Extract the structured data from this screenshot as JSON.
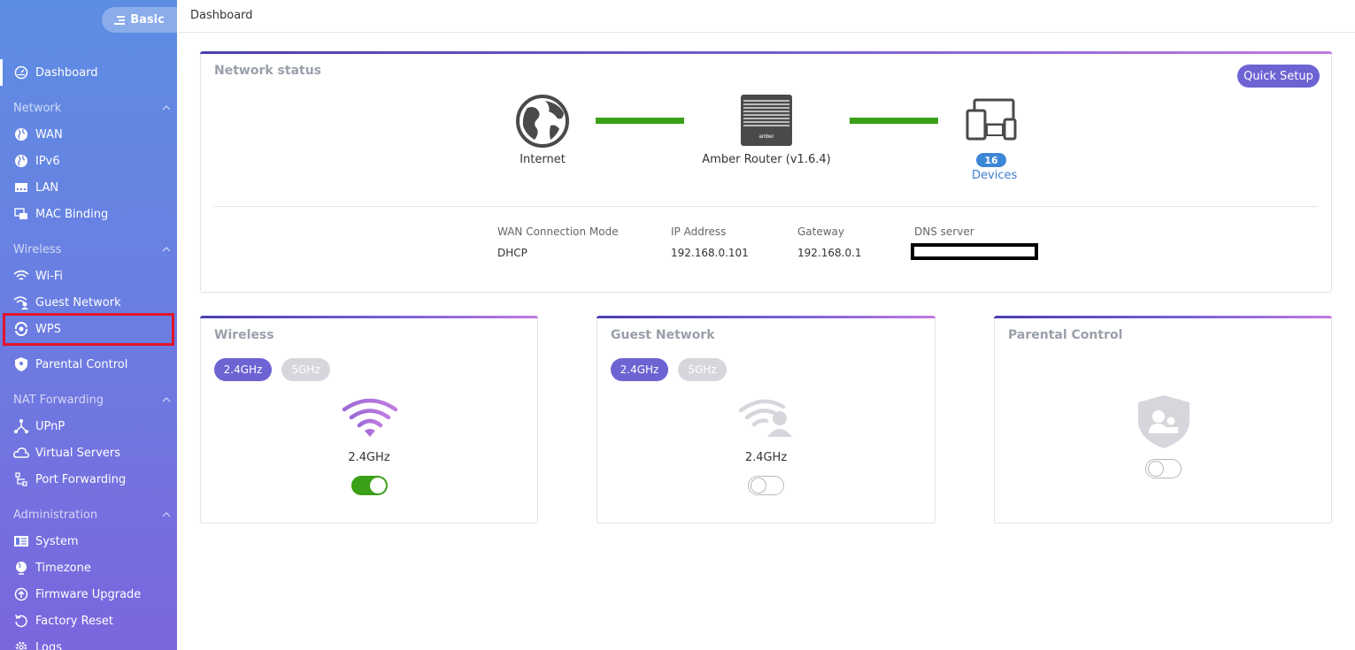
{
  "sidebar": {
    "mode_label": "Basic",
    "dashboard": "Dashboard",
    "sections": {
      "network": "Network",
      "wireless": "Wireless",
      "nat": "NAT Forwarding",
      "admin": "Administration"
    },
    "items": {
      "wan": "WAN",
      "ipv6": "IPv6",
      "lan": "LAN",
      "mac_binding": "MAC Binding",
      "wifi": "Wi-Fi",
      "guest": "Guest Network",
      "wps": "WPS",
      "parental": "Parental Control",
      "upnp": "UPnP",
      "virtual_servers": "Virtual Servers",
      "port_forwarding": "Port Forwarding",
      "system": "System",
      "timezone": "Timezone",
      "firmware": "Firmware Upgrade",
      "factory_reset": "Factory Reset",
      "logs": "Logs"
    }
  },
  "topbar": {
    "breadcrumb": "Dashboard"
  },
  "network_status": {
    "title": "Network status",
    "quick_setup": "Quick Setup",
    "internet_label": "Internet",
    "router_label": "Amber Router (v1.6.4)",
    "router_brand": "amber",
    "device_count": "16",
    "devices_label": "Devices",
    "info": {
      "mode_label": "WAN Connection Mode",
      "mode_value": "DHCP",
      "ip_label": "IP Address",
      "ip_value": "192.168.0.101",
      "gw_label": "Gateway",
      "gw_value": "192.168.0.1",
      "dns_label": "DNS server"
    }
  },
  "wireless_card": {
    "title": "Wireless",
    "tab_24": "2.4GHz",
    "tab_5": "5GHz",
    "band": "2.4GHz",
    "enabled": true
  },
  "guest_card": {
    "title": "Guest Network",
    "tab_24": "2.4GHz",
    "tab_5": "5GHz",
    "band": "2.4GHz",
    "enabled": false
  },
  "parental_card": {
    "title": "Parental Control",
    "enabled": false
  },
  "colors": {
    "accent": "#6d63d3",
    "toggle_on": "#3aa017",
    "link": "#3c7fd0",
    "highlight": "#e0132a"
  }
}
